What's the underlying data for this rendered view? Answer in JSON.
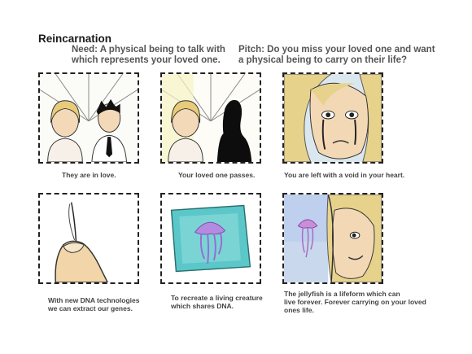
{
  "header": {
    "title": "Reincarnation",
    "need": "Need: A physical being to talk with\nwhich represents your loved one.",
    "pitch": "Pitch: Do you miss your loved one and want\na physical being to carry on their life?"
  },
  "panels": [
    {
      "caption": "They are in love."
    },
    {
      "caption": "Your loved one passes."
    },
    {
      "caption": "You are left with a void in your heart."
    },
    {
      "caption": "With new DNA technologies\nwe can extract our genes."
    },
    {
      "caption": "To recreate a living creature\nwhich shares DNA."
    },
    {
      "caption": "The jellyfish is a lifeform which can\nlive forever. Forever carrying on your loved\nones life."
    }
  ]
}
